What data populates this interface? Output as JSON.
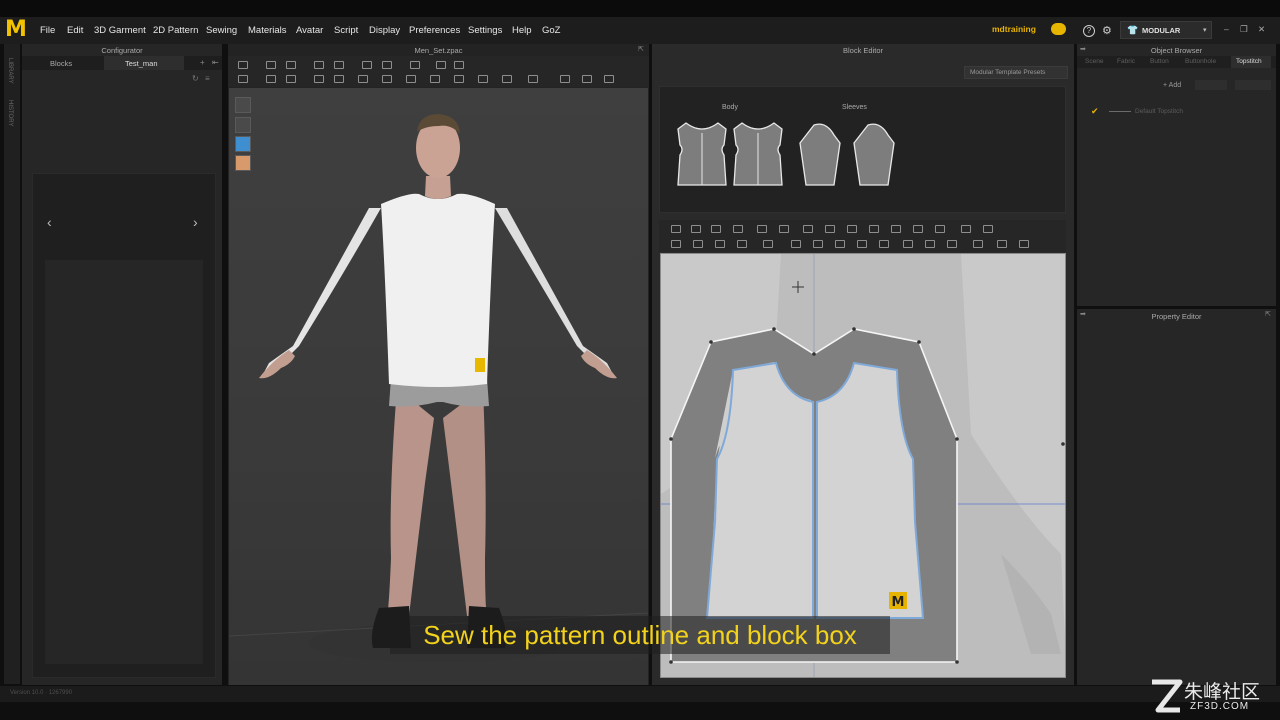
{
  "menu": [
    "File",
    "Edit",
    "3D Garment",
    "2D Pattern",
    "Sewing",
    "Materials",
    "Avatar",
    "Script",
    "Display",
    "Preferences",
    "Settings",
    "Help",
    "GoZ"
  ],
  "user": "mdtraining",
  "workspace": "MODULAR",
  "configurator": {
    "title": "Configurator",
    "tabs": [
      "Blocks",
      "Test_man"
    ],
    "side_tabs": [
      "LIBRARY",
      "HISTORY"
    ]
  },
  "viewport_title": "Men_Set.zpac",
  "block_editor": {
    "title": "Block Editor",
    "presets_button": "Modular Template Presets",
    "groups": [
      {
        "label": "Body"
      },
      {
        "label": "Sleeves"
      }
    ]
  },
  "object_browser": {
    "title": "Object Browser",
    "tabs": [
      "Scene",
      "Fabric",
      "Button",
      "Buttonhole",
      "Topstitch"
    ],
    "add_label": "+ Add",
    "item": "Default Topstitch"
  },
  "property_editor": {
    "title": "Property Editor"
  },
  "caption": "Sew the pattern outline and block box",
  "footer": "Version 10.0  · 1267990",
  "watermark": {
    "main": "朱峰社区",
    "sub": "ZF3D.COM"
  },
  "colors": {
    "accent": "#f2c200",
    "caption": "#f3d21b"
  }
}
